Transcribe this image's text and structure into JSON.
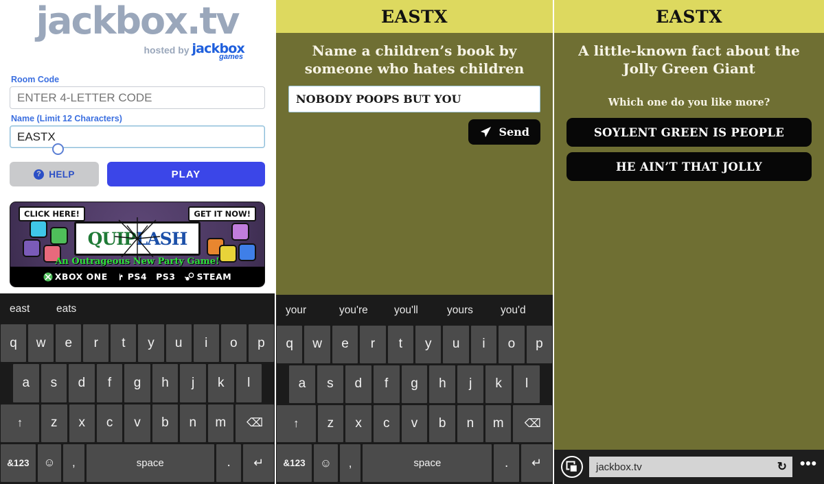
{
  "panels": {
    "login": {
      "logo": {
        "main": "jackbox.tv",
        "hosted_by": "hosted by",
        "brand": "jackbox",
        "brand_sub": "games"
      },
      "room_code": {
        "label": "Room Code",
        "placeholder": "ENTER 4-LETTER CODE",
        "value": ""
      },
      "name": {
        "label": "Name (Limit 12 Characters)",
        "value": "EASTX",
        "placeholder": ""
      },
      "buttons": {
        "help": "HELP",
        "play": "PLAY"
      },
      "ad": {
        "left_bubble": "CLICK HERE!",
        "right_bubble": "GET IT NOW!",
        "logo_part1": "QUIP",
        "logo_part2": "LASH",
        "tagline": "An Outrageous New Party Game!",
        "platforms": [
          "XBOX ONE",
          "PS4",
          "PS3",
          "STEAM"
        ]
      },
      "keyboard": {
        "suggestions": [
          "east",
          "eats"
        ],
        "row1": [
          "q",
          "w",
          "e",
          "r",
          "t",
          "y",
          "u",
          "i",
          "o",
          "p"
        ],
        "row2": [
          "a",
          "s",
          "d",
          "f",
          "g",
          "h",
          "j",
          "k",
          "l"
        ],
        "row3": [
          "↑",
          "z",
          "x",
          "c",
          "v",
          "b",
          "n",
          "m",
          "⌫"
        ],
        "row4": [
          "&123",
          "☺",
          ",",
          "space",
          ".",
          "↵"
        ]
      }
    },
    "middle": {
      "header_title": "EASTX",
      "prompt": "Name a children’s book by someone who hates children",
      "answer_value": "NOBODY POOPS BUT YOU",
      "send_label": "Send",
      "keyboard": {
        "suggestions": [
          "your",
          "you're",
          "you'll",
          "yours",
          "you'd"
        ],
        "row1": [
          "q",
          "w",
          "e",
          "r",
          "t",
          "y",
          "u",
          "i",
          "o",
          "p"
        ],
        "row2": [
          "a",
          "s",
          "d",
          "f",
          "g",
          "h",
          "j",
          "k",
          "l"
        ],
        "row3": [
          "↑",
          "z",
          "x",
          "c",
          "v",
          "b",
          "n",
          "m",
          "⌫"
        ],
        "row4": [
          "&123",
          "☺",
          ",",
          "space",
          ".",
          "↵"
        ]
      }
    },
    "right": {
      "header_title": "EASTX",
      "prompt": "A little-known fact about the Jolly Green Giant",
      "subprompt": "Which one do you like more?",
      "choices": [
        "SOYLENT GREEN IS PEOPLE",
        "HE AIN’T THAT JOLLY"
      ],
      "browser": {
        "url": "jackbox.tv",
        "refresh_glyph": "↻",
        "more_glyph": "•••"
      }
    }
  },
  "colors": {
    "header_yellow": "#ddd95f",
    "body_olive": "#6f6f33",
    "play_blue": "#3b46e8",
    "label_blue": "#3b6fe0",
    "keyboard_bg": "#1b1b1b",
    "key_gray": "#4b4b4b"
  }
}
